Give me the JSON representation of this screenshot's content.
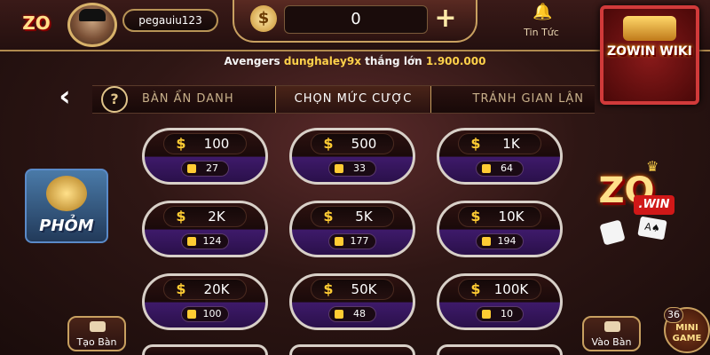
{
  "header": {
    "logo_text": "ZO",
    "username": "pegauiu123",
    "balance": "0",
    "currency_symbol": "$",
    "plus_label": "+",
    "news_label": "Tin Tức"
  },
  "ticker": {
    "prefix": "Avengers",
    "player": "dunghaley9x",
    "mid": "thắng lớn",
    "amount": "1.900.000"
  },
  "promo": {
    "text": "ZOWIN WIKI"
  },
  "tabs": {
    "help_label": "?",
    "items": [
      {
        "label": "BÀN ẨN DANH"
      },
      {
        "label": "CHỌN MỨC CƯỢC",
        "active": true
      },
      {
        "label": "TRÁNH GIAN LẬN"
      }
    ]
  },
  "side": {
    "game_label": "PHỎM",
    "brand_text": "ZO",
    "brand_badge": ".WIN",
    "card_text": "A♠"
  },
  "tables": [
    {
      "stake": "100",
      "players": "27"
    },
    {
      "stake": "500",
      "players": "33"
    },
    {
      "stake": "1K",
      "players": "64"
    },
    {
      "stake": "2K",
      "players": "124"
    },
    {
      "stake": "5K",
      "players": "177"
    },
    {
      "stake": "10K",
      "players": "194"
    },
    {
      "stake": "20K",
      "players": "100"
    },
    {
      "stake": "50K",
      "players": "48"
    },
    {
      "stake": "100K",
      "players": "10"
    }
  ],
  "bottom": {
    "create_label": "Tạo Bàn",
    "join_label": "Vào Bàn",
    "mini_badge": "36",
    "mini_label": "MINI GAME"
  },
  "colors": {
    "accent_gold": "#c8a060",
    "highlight_yellow": "#ffd24a",
    "table_purple": "#3e1a6a"
  }
}
